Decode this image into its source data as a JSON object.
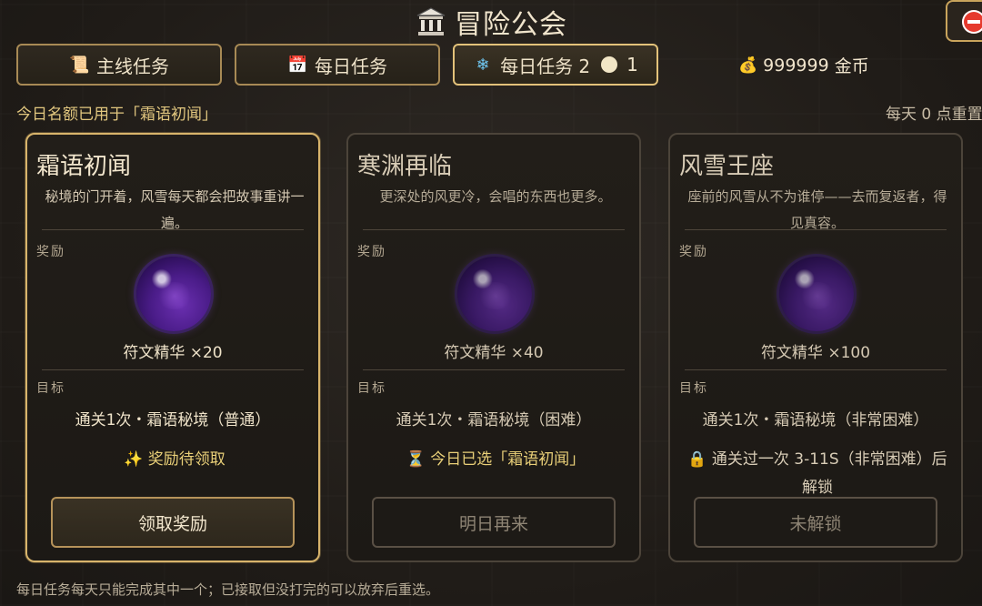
{
  "header": {
    "title": "冒险公会",
    "title_icon": "bank-building-icon",
    "close_icon": "no-entry-icon"
  },
  "tabs": [
    {
      "label": "主线任务",
      "icon": "scroll-icon",
      "active": false
    },
    {
      "label": "每日任务",
      "icon": "calendar-icon",
      "active": false
    },
    {
      "label": "每日任务 2",
      "icon": "snowflake-icon",
      "active": true,
      "count": "1"
    }
  ],
  "currency": {
    "amount": "999999",
    "unit": "金币",
    "icon": "money-bag-icon"
  },
  "quota_text": "今日名额已用于「霜语初闻」",
  "reset_text": "每天 0 点重置",
  "cards": [
    {
      "title": "霜语初闻",
      "desc": "秘境的门开着，风雪每天都会把故事重讲一遍。",
      "reward_label": "奖励",
      "reward_item": "符文精华",
      "reward_qty": "×20",
      "goal_label": "目标",
      "goal": "通关1次・霜语秘境（普通）",
      "status_icon": "✨",
      "status": "奖励待领取",
      "button": "领取奖励"
    },
    {
      "title": "寒渊再临",
      "desc": "更深处的风更冷，会唱的东西也更多。",
      "reward_label": "奖励",
      "reward_item": "符文精华",
      "reward_qty": "×40",
      "goal_label": "目标",
      "goal": "通关1次・霜语秘境（困难）",
      "status_icon": "⏳",
      "status": "今日已选「霜语初闻」",
      "button": "明日再来"
    },
    {
      "title": "风雪王座",
      "desc": "座前的风雪从不为谁停——去而复返者，得见真容。",
      "reward_label": "奖励",
      "reward_item": "符文精华",
      "reward_qty": "×100",
      "goal_label": "目标",
      "goal": "通关1次・霜语秘境（非常困难）",
      "status_icon": "🔒",
      "status": "通关过一次 3-11S（非常困难）后解锁",
      "button": "未解锁"
    }
  ],
  "footer": "每日任务每天只能完成其中一个；已接取但没打完的可以放弃后重选。",
  "colors": {
    "accent": "#d8b46b",
    "status_text": "#e9cf78",
    "orb": "#6a2fb0"
  }
}
